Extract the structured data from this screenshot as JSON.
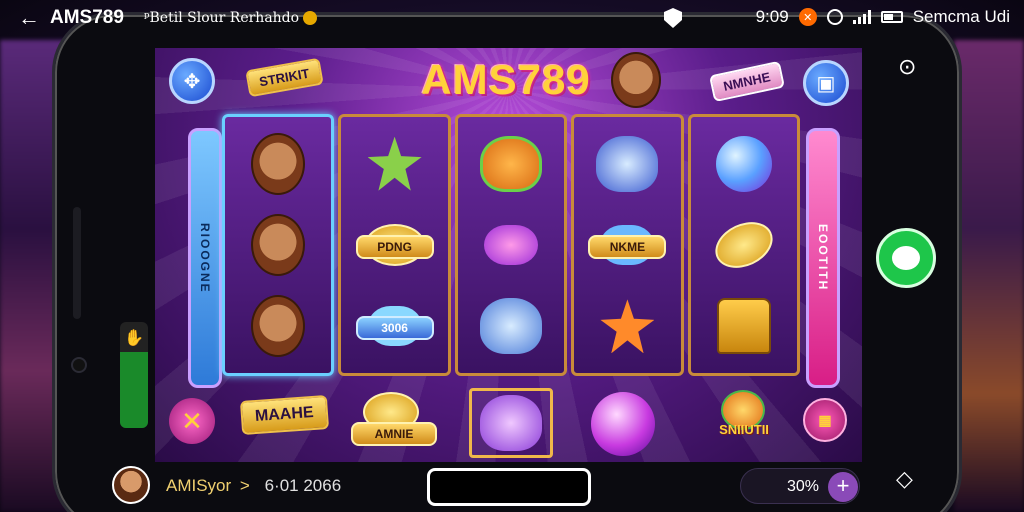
{
  "status_bar": {
    "app_title": "AMS789",
    "subtitle": "ᵖBetil Slour Rerhahdo",
    "time": "9:09",
    "right_text": "Semcma Udi"
  },
  "game": {
    "logo": "AMS789",
    "banner_left": "STRIKIT",
    "banner_right": "NMNHE",
    "panel_left": "RIOOGNE",
    "panel_right": "EOOTITH",
    "reels": [
      [
        {
          "kind": "hero"
        },
        {
          "kind": "hero"
        },
        {
          "kind": "hero"
        }
      ],
      [
        {
          "kind": "gem-red"
        },
        {
          "kind": "coin",
          "label": "PDNG"
        },
        {
          "kind": "gem-blue",
          "label": "3006"
        }
      ],
      [
        {
          "kind": "cat-orange"
        },
        {
          "kind": "gem-purple"
        },
        {
          "kind": "cat-blue"
        }
      ],
      [
        {
          "kind": "cat-blue"
        },
        {
          "kind": "gem-blue",
          "label": "NKME"
        },
        {
          "kind": "star-orange"
        }
      ],
      [
        {
          "kind": "orb"
        },
        {
          "kind": "coin"
        },
        {
          "kind": "chest"
        }
      ]
    ],
    "bottom_row": {
      "banner_left": "MAAHE",
      "coin_label": "AMNIE",
      "fruit_label": "SNIIUTII"
    }
  },
  "bottom_bar": {
    "username": "AMISyor",
    "separator": ">",
    "date": "6·01 2066",
    "percent": "30%",
    "plus": "+"
  },
  "colors": {
    "accent_purple": "#8a4ab8",
    "chat_green": "#1ec64a",
    "logo_gold": "#ffd23a",
    "panel_pink": "#d81e86",
    "panel_blue": "#2e7ad8"
  }
}
